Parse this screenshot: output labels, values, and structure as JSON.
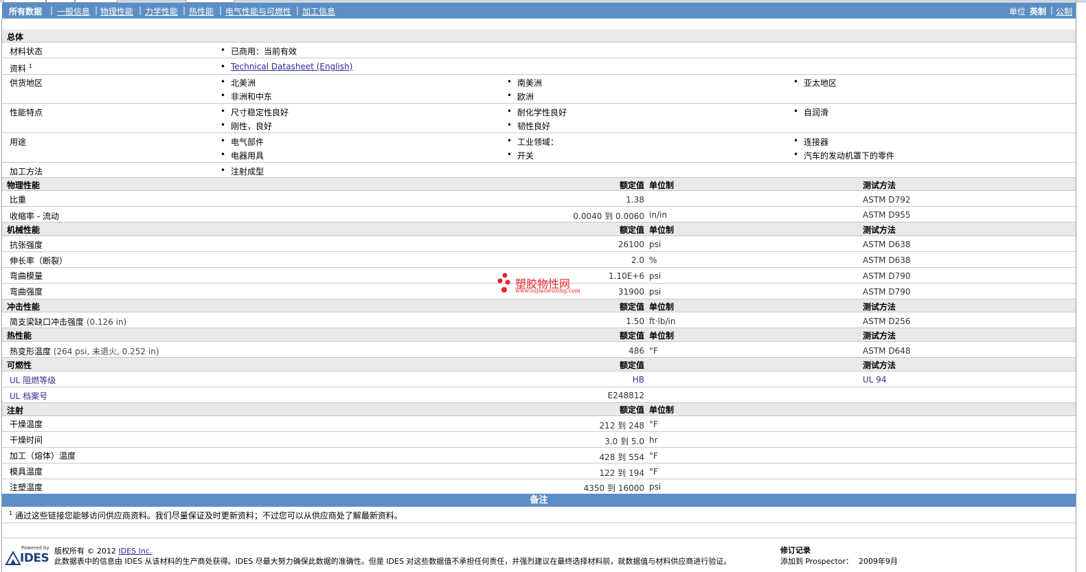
{
  "nav": {
    "items": [
      "所有数据",
      "一般信息",
      "物理性能",
      "力学性能",
      "热性能",
      "电气性能与可燃性",
      "加工信息"
    ],
    "unit_label": "单位",
    "unit_imperial": "英制",
    "unit_metric": "公制"
  },
  "general": {
    "title": "总体",
    "material_status_label": "材料状态",
    "material_status_value": "已商用：当前有效",
    "docs_label": "资料",
    "docs_sup": "1",
    "docs_link": "Technical Datasheet (English)",
    "supply_label": "供货地区",
    "supply": [
      "北美洲",
      "南美洲",
      "亚太地区",
      "非洲和中东",
      "欧洲"
    ],
    "features_label": "性能特点",
    "features": [
      "尺寸稳定性良好",
      "耐化学性良好",
      "自润滑",
      "刚性，良好",
      "韧性良好"
    ],
    "uses_label": "用途",
    "uses": [
      "电气部件",
      "工业领域：",
      "连接器",
      "电器用具",
      "开关",
      "汽车的发动机罩下的零件"
    ],
    "processing_label": "加工方法",
    "processing_value": "注射成型"
  },
  "headers": {
    "value": "额定值",
    "unit": "单位制",
    "method": "测试方法"
  },
  "physical": {
    "title": "物理性能",
    "rows": [
      {
        "label": "比重",
        "value": "1.38",
        "unit": "",
        "method": "ASTM D792"
      },
      {
        "label": "收缩率 - 流动",
        "value": "0.0040 到 0.0060",
        "unit": "in/in",
        "method": "ASTM D955"
      }
    ]
  },
  "mechanical": {
    "title": "机械性能",
    "rows": [
      {
        "label": "抗张强度",
        "value": "26100",
        "unit": "psi",
        "method": "ASTM D638"
      },
      {
        "label": "伸长率（断裂）",
        "value": "2.0",
        "unit": "%",
        "method": "ASTM D638"
      },
      {
        "label": "弯曲模量",
        "value": "1.10E+6",
        "unit": "psi",
        "method": "ASTM D790"
      },
      {
        "label": "弯曲强度",
        "value": "31900",
        "unit": "psi",
        "method": "ASTM D790"
      }
    ]
  },
  "impact": {
    "title": "冲击性能",
    "rows": [
      {
        "label": "简支梁缺口冲击强度",
        "cond": "(0.126 in)",
        "value": "1.50",
        "unit": "ft·lb/in",
        "method": "ASTM D256"
      }
    ]
  },
  "thermal": {
    "title": "热性能",
    "rows": [
      {
        "label": "热变形温度",
        "cond": "(264 psi, 未退火, 0.252 in)",
        "value": "486",
        "unit": "°F",
        "method": "ASTM D648"
      }
    ]
  },
  "flammability": {
    "title": "可燃性",
    "rows": [
      {
        "label": "UL 阻燃等级",
        "value": "HB",
        "unit": "",
        "method": "UL 94"
      },
      {
        "label": "UL 档案号",
        "value": "E248812",
        "unit": "",
        "method": ""
      }
    ]
  },
  "injection": {
    "title": "注射",
    "rows": [
      {
        "label": "干燥温度",
        "value": "212 到  248",
        "unit": "°F"
      },
      {
        "label": "干燥时间",
        "value": "3.0 到  5.0",
        "unit": "hr"
      },
      {
        "label": "加工（熔体）温度",
        "value": "428 到  554",
        "unit": "°F"
      },
      {
        "label": "模具温度",
        "value": "122 到  194",
        "unit": "°F"
      },
      {
        "label": "注塑温度",
        "value": "4350 到  16000",
        "unit": "psi"
      }
    ]
  },
  "notes": {
    "title": "备注",
    "sup": "1",
    "text": "通过这些链接您能够访问供应商资料。我们尽量保证及时更新资料；不过您可以从供应商处了解最新资料。"
  },
  "watermark": {
    "title": "塑胶物性网",
    "url": "www.sujiaowuxing.com"
  },
  "footer": {
    "powered_by": "Powered by",
    "logo": "IDES",
    "copyright": "版权所有 © 2012",
    "company_link": "IDES Inc.",
    "disclaimer": "此数据表中的信息由 IDES 从该材料的生产商处获得。IDES 尽最大努力确保此数据的准确性。但是 IDES 对这些数据值不承担任何责任，并强烈建议在最终选择材料前，就数据值与材料供应商进行验证。",
    "revision_title": "修订记录",
    "added_label": "添加到 Prospector：",
    "added_value": "2009年9月"
  },
  "colors": {
    "nav_bg": "#5b8ec4",
    "section_bg": "#e9e9e9",
    "link": "#2a2aa0",
    "watermark_red": "#e8232a"
  }
}
